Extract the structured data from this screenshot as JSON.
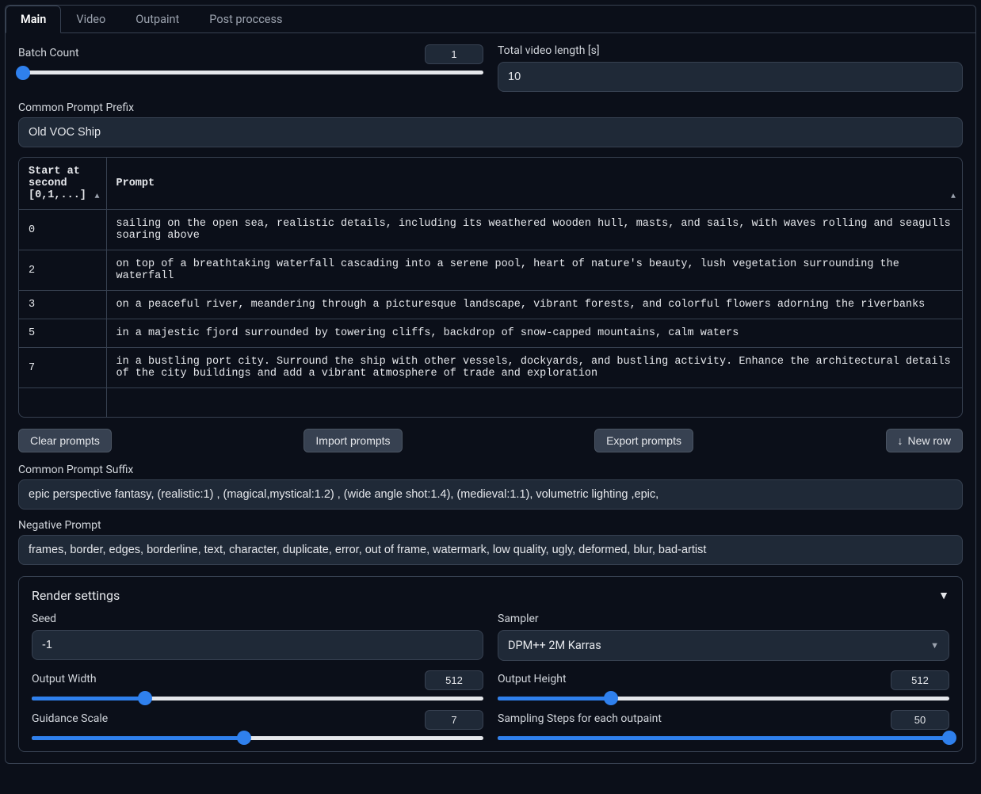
{
  "tabs": [
    "Main",
    "Video",
    "Outpaint",
    "Post proccess"
  ],
  "active_tab": 0,
  "batch_count": {
    "label": "Batch Count",
    "value": "1",
    "fill_pct": 1
  },
  "total_video_length": {
    "label": "Total video length [s]",
    "value": "10"
  },
  "common_prefix": {
    "label": "Common Prompt Prefix",
    "value": "Old VOC Ship"
  },
  "table": {
    "col_start": "Start at second [0,1,...]",
    "col_prompt": "Prompt",
    "rows": [
      {
        "start": "0",
        "prompt": "sailing on the open sea, realistic details, including its weathered wooden hull, masts, and sails, with waves rolling and seagulls soaring above"
      },
      {
        "start": "2",
        "prompt": "on top of a breathtaking waterfall cascading into a serene pool, heart of nature's beauty, lush vegetation surrounding the waterfall"
      },
      {
        "start": "3",
        "prompt": "on a peaceful river, meandering through a picturesque landscape, vibrant forests, and colorful flowers adorning the riverbanks"
      },
      {
        "start": "5",
        "prompt": "in a majestic fjord surrounded by towering cliffs, backdrop of snow-capped mountains, calm waters"
      },
      {
        "start": "7",
        "prompt": "in a bustling port city. Surround the ship with other vessels, dockyards, and bustling activity. Enhance the architectural details of the city buildings and add a vibrant atmosphere of trade and exploration"
      }
    ]
  },
  "buttons": {
    "clear": "Clear prompts",
    "import": "Import prompts",
    "export": "Export prompts",
    "new_row": "New row"
  },
  "common_suffix": {
    "label": "Common Prompt Suffix",
    "value": "epic perspective fantasy, (realistic:1) , (magical,mystical:1.2) , (wide angle shot:1.4), (medieval:1.1), volumetric lighting ,epic,"
  },
  "negative_prompt": {
    "label": "Negative Prompt",
    "value": "frames, border, edges, borderline, text, character, duplicate, error, out of frame, watermark, low quality, ugly, deformed, blur, bad-artist"
  },
  "render": {
    "title": "Render settings",
    "seed": {
      "label": "Seed",
      "value": "-1"
    },
    "sampler": {
      "label": "Sampler",
      "value": "DPM++ 2M Karras"
    },
    "width": {
      "label": "Output Width",
      "value": "512",
      "fill_pct": 25
    },
    "height": {
      "label": "Output Height",
      "value": "512",
      "fill_pct": 25
    },
    "guidance": {
      "label": "Guidance Scale",
      "value": "7",
      "fill_pct": 47
    },
    "steps": {
      "label": "Sampling Steps for each outpaint",
      "value": "50",
      "fill_pct": 100
    }
  }
}
